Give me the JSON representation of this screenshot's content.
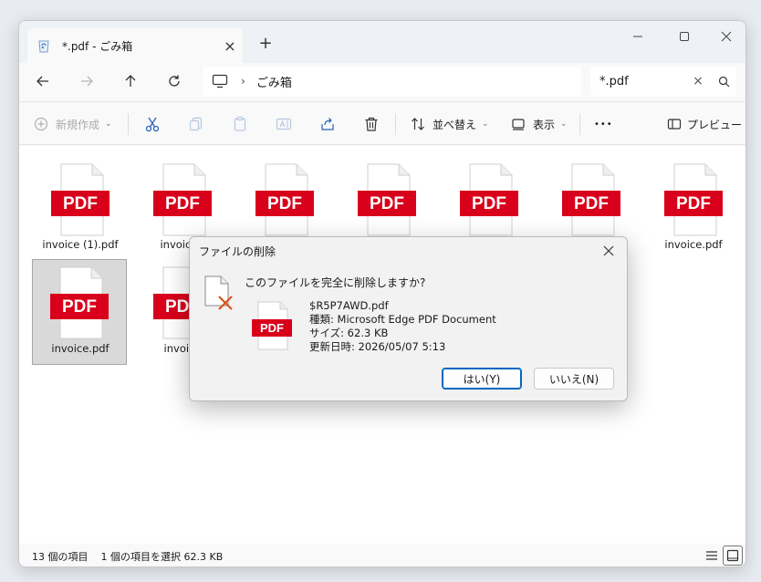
{
  "tab": {
    "title": "*.pdf - ごみ箱",
    "close": "×",
    "new_tab": "+"
  },
  "address": {
    "crumb": "ごみ箱",
    "separator": "›"
  },
  "search": {
    "value": "*.pdf",
    "clear": "×"
  },
  "commands": {
    "new_label": "新規作成",
    "sort_label": "並べ替え",
    "view_label": "表示",
    "more": "•••",
    "preview_label": "プレビュー",
    "caret": "⌄"
  },
  "files": [
    {
      "name": "invoice (1).pdf"
    },
    {
      "name": "invoice ("
    },
    {
      "name": ""
    },
    {
      "name": ""
    },
    {
      "name": ""
    },
    {
      "name": ""
    },
    {
      "name": "invoice.pdf"
    },
    {
      "name": "invoice.pdf"
    },
    {
      "name": "invoice"
    }
  ],
  "pdf_badge": "PDF",
  "status": {
    "count": "13 個の項目",
    "selected": "1 個の項目を選択  62.3 KB"
  },
  "dialog": {
    "title": "ファイルの削除",
    "question": "このファイルを完全に削除しますか?",
    "file_name": "$R5P7AWD.pdf",
    "file_type": "種類: Microsoft Edge PDF Document",
    "file_size": "サイズ: 62.3 KB",
    "file_date": "更新日時: 2026/05/07 5:13",
    "yes_label": "はい(Y)",
    "no_label": "いいえ(N)"
  },
  "colors": {
    "pdf_red": "#d9001b",
    "accent": "#0067c0"
  }
}
